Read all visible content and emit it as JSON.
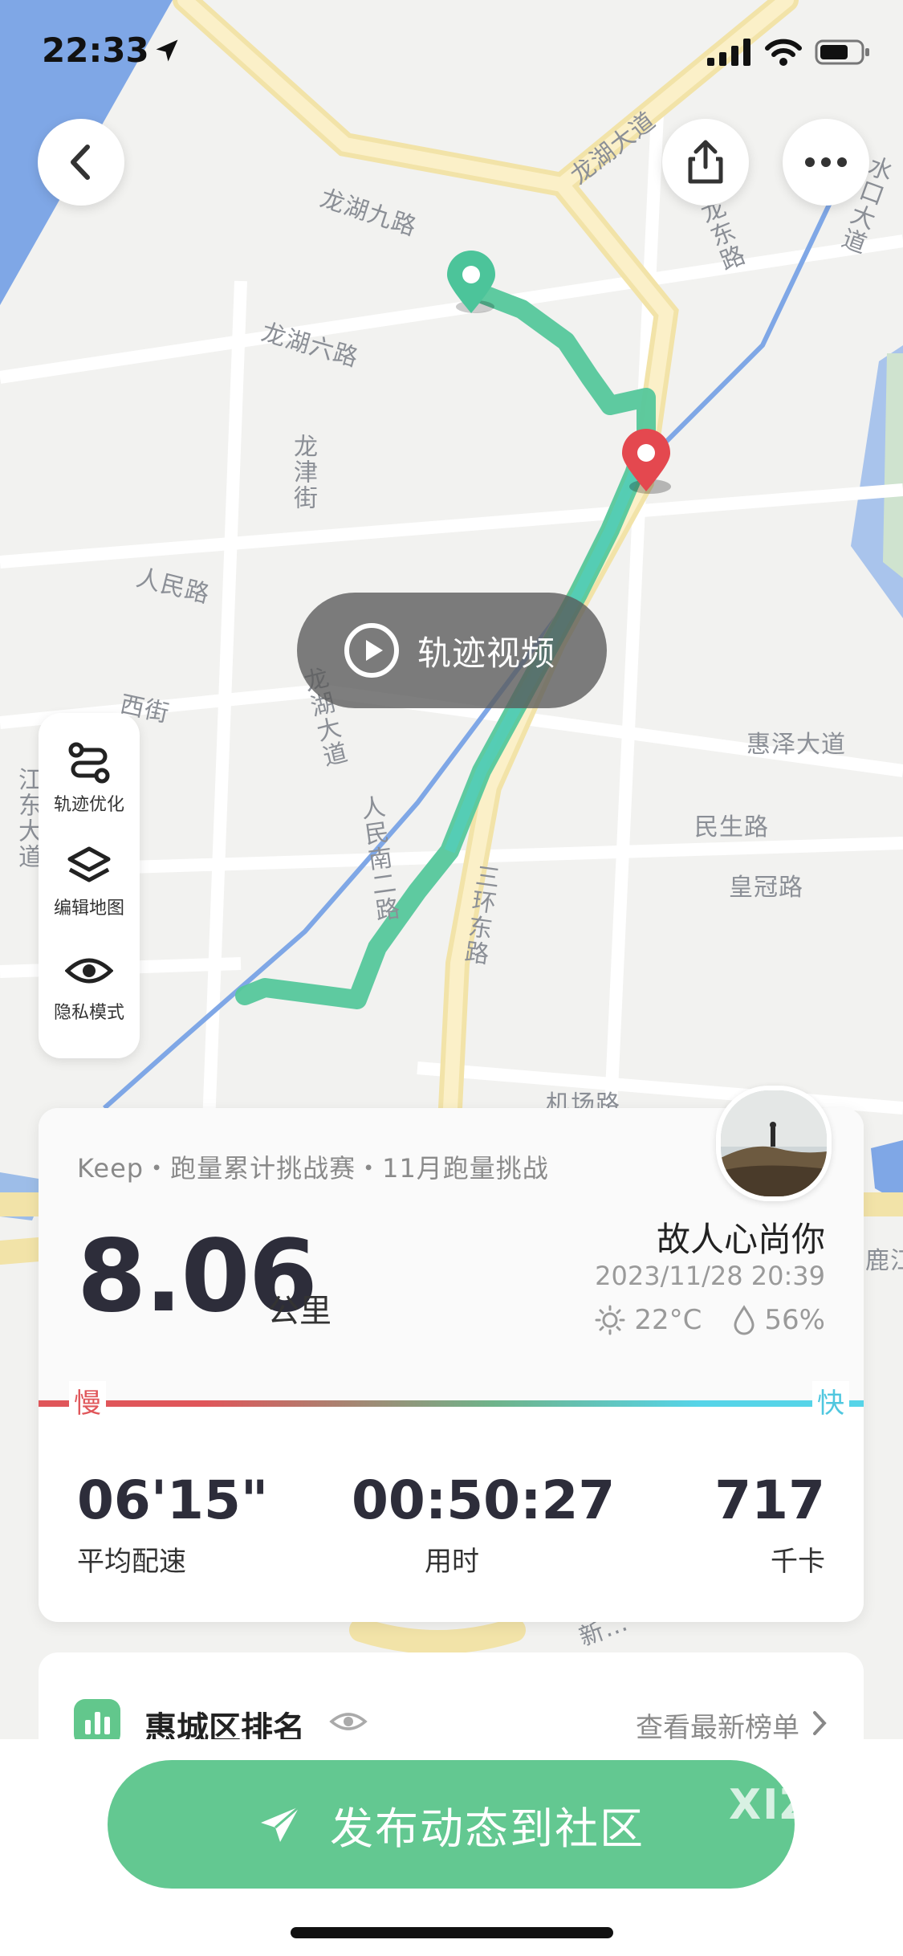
{
  "status_bar": {
    "time": "22:33"
  },
  "map": {
    "labels": [
      "龙湖九路",
      "龙湖六路",
      "龙津街",
      "人民路",
      "西街",
      "龙湖大道",
      "人民南二路",
      "三环东路",
      "机场路",
      "惠泽大道",
      "民生路",
      "皇冠路",
      "江东大道",
      "龙湖大道",
      "龙东路",
      "水口大道",
      "鹿江",
      "新…"
    ]
  },
  "video_button": {
    "label": "轨迹视频"
  },
  "tools": [
    {
      "icon": "route-icon",
      "label": "轨迹优化"
    },
    {
      "icon": "layers-icon",
      "label": "编辑地图"
    },
    {
      "icon": "eye-icon",
      "label": "隐私模式"
    }
  ],
  "summary": {
    "challenge": "Keep・跑量累计挑战赛・11月跑量挑战",
    "distance": "8.06",
    "distance_unit": "公里",
    "username": "故人心尚你",
    "datetime": "2023/11/28 20:39",
    "temperature": "22°C",
    "humidity": "56%",
    "slow_label": "慢",
    "fast_label": "快"
  },
  "stats": [
    {
      "value": "06'15\"",
      "label": "平均配速"
    },
    {
      "value": "00:50:27",
      "label": "用时"
    },
    {
      "value": "717",
      "label": "千卡"
    }
  ],
  "ranking": {
    "title": "惠城区排名",
    "link": "查看最新榜单"
  },
  "publish_button": {
    "label": "发布动态到社区"
  },
  "watermark": "XIZI",
  "colors": {
    "route": "#4cc49a",
    "accent": "#63c891",
    "slow": "#e0565a",
    "fast": "#56d4e8"
  }
}
